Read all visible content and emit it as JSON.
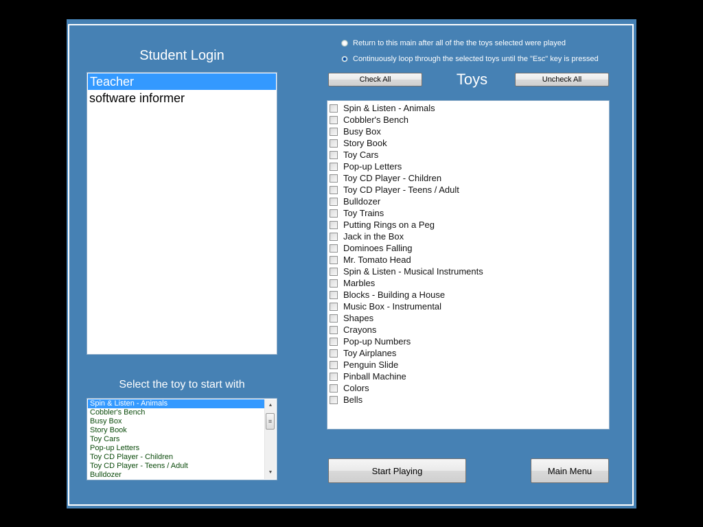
{
  "login": {
    "title": "Student Login",
    "users": [
      {
        "name": "Teacher",
        "selected": true
      },
      {
        "name": "software informer",
        "selected": false
      }
    ]
  },
  "start_toy": {
    "title": "Select the toy to start with",
    "items": [
      {
        "name": "Spin & Listen - Animals",
        "selected": true
      },
      {
        "name": "Cobbler's Bench",
        "selected": false
      },
      {
        "name": "Busy Box",
        "selected": false
      },
      {
        "name": "Story Book",
        "selected": false
      },
      {
        "name": "Toy Cars",
        "selected": false
      },
      {
        "name": "Pop-up Letters",
        "selected": false
      },
      {
        "name": "Toy CD Player - Children",
        "selected": false
      },
      {
        "name": "Toy CD Player - Teens / Adult",
        "selected": false
      },
      {
        "name": "Bulldozer",
        "selected": false
      }
    ],
    "scroll_up_icon": "▲",
    "scroll_down_icon": "▼",
    "thumb_grip_icon": "≡"
  },
  "options": {
    "radios": [
      {
        "label": "Return to this main after all of the the toys selected were played",
        "checked": false
      },
      {
        "label": "Continuously loop through the selected toys until the \"Esc\" key is pressed",
        "checked": true
      }
    ]
  },
  "toys": {
    "title": "Toys",
    "check_all_label": "Check All",
    "uncheck_all_label": "Uncheck All",
    "items": [
      {
        "name": "Spin & Listen - Animals",
        "checked": false
      },
      {
        "name": "Cobbler's Bench",
        "checked": false
      },
      {
        "name": "Busy Box",
        "checked": false
      },
      {
        "name": "Story Book",
        "checked": false
      },
      {
        "name": "Toy Cars",
        "checked": false
      },
      {
        "name": "Pop-up Letters",
        "checked": false
      },
      {
        "name": "Toy CD Player - Children",
        "checked": false
      },
      {
        "name": "Toy CD Player - Teens / Adult",
        "checked": false
      },
      {
        "name": "Bulldozer",
        "checked": false
      },
      {
        "name": "Toy Trains",
        "checked": false
      },
      {
        "name": "Putting Rings on a Peg",
        "checked": false
      },
      {
        "name": "Jack in the Box",
        "checked": false
      },
      {
        "name": "Dominoes Falling",
        "checked": false
      },
      {
        "name": "Mr. Tomato Head",
        "checked": false
      },
      {
        "name": "Spin & Listen - Musical Instruments",
        "checked": false
      },
      {
        "name": "Marbles",
        "checked": false
      },
      {
        "name": "Blocks - Building a House",
        "checked": false
      },
      {
        "name": "Music Box - Instrumental",
        "checked": false
      },
      {
        "name": "Shapes",
        "checked": false
      },
      {
        "name": "Crayons",
        "checked": false
      },
      {
        "name": "Pop-up Numbers",
        "checked": false
      },
      {
        "name": "Toy Airplanes",
        "checked": false
      },
      {
        "name": "Penguin Slide",
        "checked": false
      },
      {
        "name": "Pinball Machine",
        "checked": false
      },
      {
        "name": "Colors",
        "checked": false
      },
      {
        "name": "Bells",
        "checked": false
      }
    ]
  },
  "actions": {
    "start_label": "Start Playing",
    "main_menu_label": "Main Menu"
  },
  "colors": {
    "panel": "#4681b4",
    "selection": "#3399ff"
  }
}
